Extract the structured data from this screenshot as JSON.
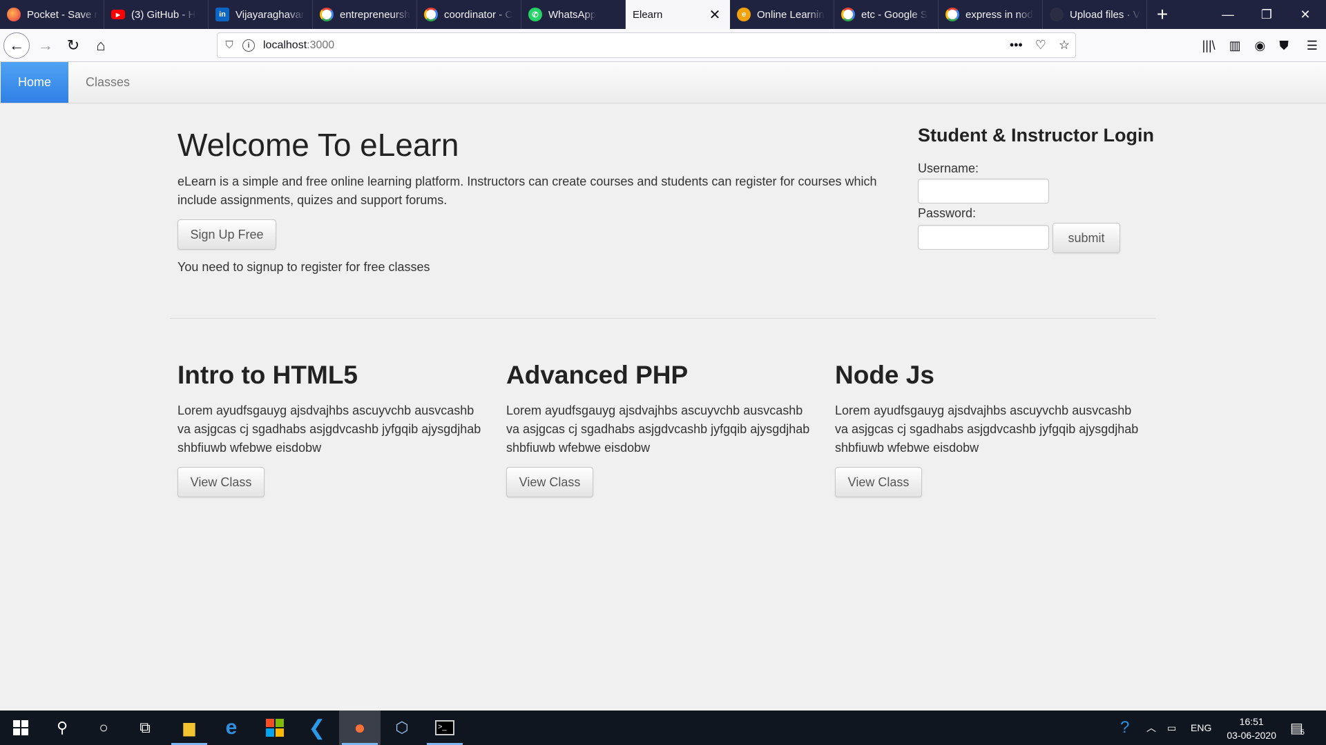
{
  "browser": {
    "tabs": [
      {
        "label": "Pocket - Save r",
        "icon": "pocket-icon"
      },
      {
        "label": "(3) GitHub - H",
        "icon": "youtube-icon"
      },
      {
        "label": "Vijayaraghavar",
        "icon": "linkedin-icon"
      },
      {
        "label": "entrepreneursh",
        "icon": "google-icon"
      },
      {
        "label": "coordinator - C",
        "icon": "google-icon"
      },
      {
        "label": "WhatsApp",
        "icon": "whatsapp-icon"
      },
      {
        "label": "Elearn",
        "icon": "none"
      },
      {
        "label": "Online Learnin",
        "icon": "elearn-favicon-icon"
      },
      {
        "label": "etc - Google S",
        "icon": "google-icon"
      },
      {
        "label": "express in nod",
        "icon": "google-icon"
      },
      {
        "label": "Upload files · V",
        "icon": "page-icon"
      }
    ],
    "active_tab_index": 6,
    "url_host": "localhost",
    "url_port": ":3000"
  },
  "app": {
    "nav": {
      "home": "Home",
      "classes": "Classes"
    },
    "hero": {
      "title": "Welcome To eLearn",
      "description": "eLearn is a simple and free online learning platform. Instructors can create courses and students can register for courses which include assignments, quizes and support forums.",
      "signup_button": "Sign Up Free",
      "note": "You need to signup to register for free classes"
    },
    "login": {
      "title": "Student & Instructor Login",
      "username_label": "Username:",
      "password_label": "Password:",
      "username_value": "",
      "password_value": "",
      "submit_label": "submit"
    },
    "classes": [
      {
        "title": "Intro to HTML5",
        "description": "Lorem ayudfsgauyg ajsdvajhbs ascuyvchb ausvcashb va asjgcas cj sgadhabs asjgdvcashb jyfgqib ajysgdjhab shbfiuwb wfebwe eisdobw",
        "button": "View Class"
      },
      {
        "title": "Advanced PHP",
        "description": "Lorem ayudfsgauyg ajsdvajhbs ascuyvchb ausvcashb va asjgcas cj sgadhabs asjgdvcashb jyfgqib ajysgdjhab shbfiuwb wfebwe eisdobw",
        "button": "View Class"
      },
      {
        "title": "Node Js",
        "description": "Lorem ayudfsgauyg ajsdvajhbs ascuyvchb ausvcashb va asjgcas cj sgadhabs asjgdvcashb jyfgqib ajysgdjhab shbfiuwb wfebwe eisdobw",
        "button": "View Class"
      }
    ]
  },
  "taskbar": {
    "language": "ENG",
    "time": "16:51",
    "date": "03-06-2020",
    "notification_count": "5"
  },
  "colors": {
    "accent": "#3a8ee6",
    "tabstrip": "#202340",
    "taskbar": "#101620"
  }
}
